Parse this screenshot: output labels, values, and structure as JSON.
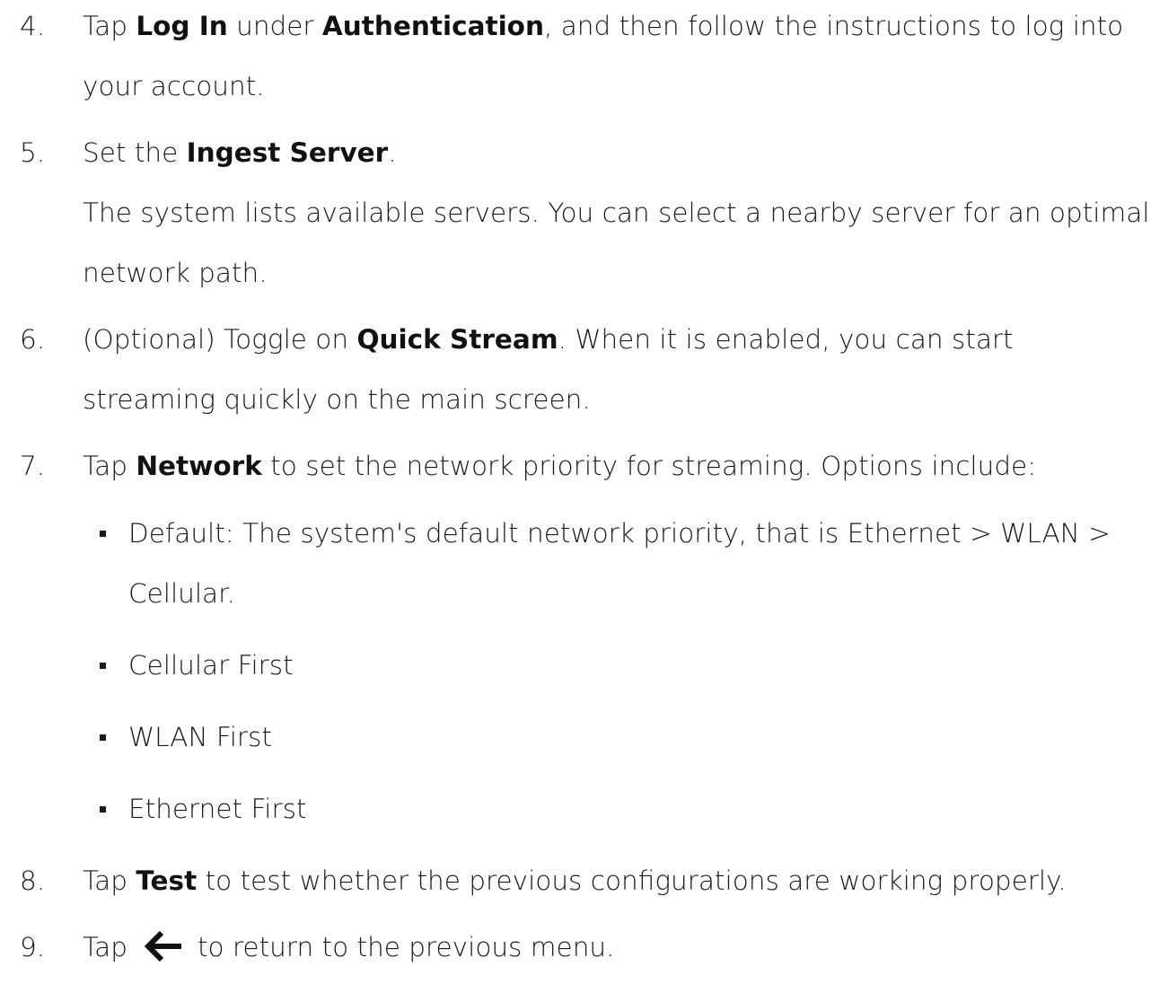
{
  "steps": [
    {
      "num": "4.",
      "parts": [
        {
          "t": "Tap "
        },
        {
          "t": "Log In",
          "b": true
        },
        {
          "t": " under "
        },
        {
          "t": "Authentication",
          "b": true
        },
        {
          "t": ", and then follow the instructions to log into your account."
        }
      ]
    },
    {
      "num": "5.",
      "parts": [
        {
          "t": "Set the "
        },
        {
          "t": "Ingest Server",
          "b": true
        },
        {
          "t": "."
        }
      ],
      "note": "The system lists available servers. You can select a nearby server for an optimal network path."
    },
    {
      "num": "6.",
      "parts": [
        {
          "t": "(Optional) Toggle on "
        },
        {
          "t": "Quick Stream",
          "b": true
        },
        {
          "t": ". When it is enabled, you can start streaming quickly on the main screen."
        }
      ]
    },
    {
      "num": "7.",
      "parts": [
        {
          "t": "Tap "
        },
        {
          "t": "Network",
          "b": true
        },
        {
          "t": " to set the network priority for streaming. Options include:"
        }
      ],
      "bullets": [
        "Default: The system's default network priority, that is Ethernet > WLAN > Cellular.",
        "Cellular First",
        "WLAN First",
        "Ethernet First"
      ]
    },
    {
      "num": "8.",
      "parts": [
        {
          "t": "Tap "
        },
        {
          "t": "Test",
          "b": true
        },
        {
          "t": " to test whether the previous configurations are working properly."
        }
      ]
    },
    {
      "num": "9.",
      "parts": [
        {
          "t": "Tap"
        },
        {
          "icon": "back-arrow-icon"
        },
        {
          "t": "to return to the previous menu."
        }
      ]
    }
  ]
}
